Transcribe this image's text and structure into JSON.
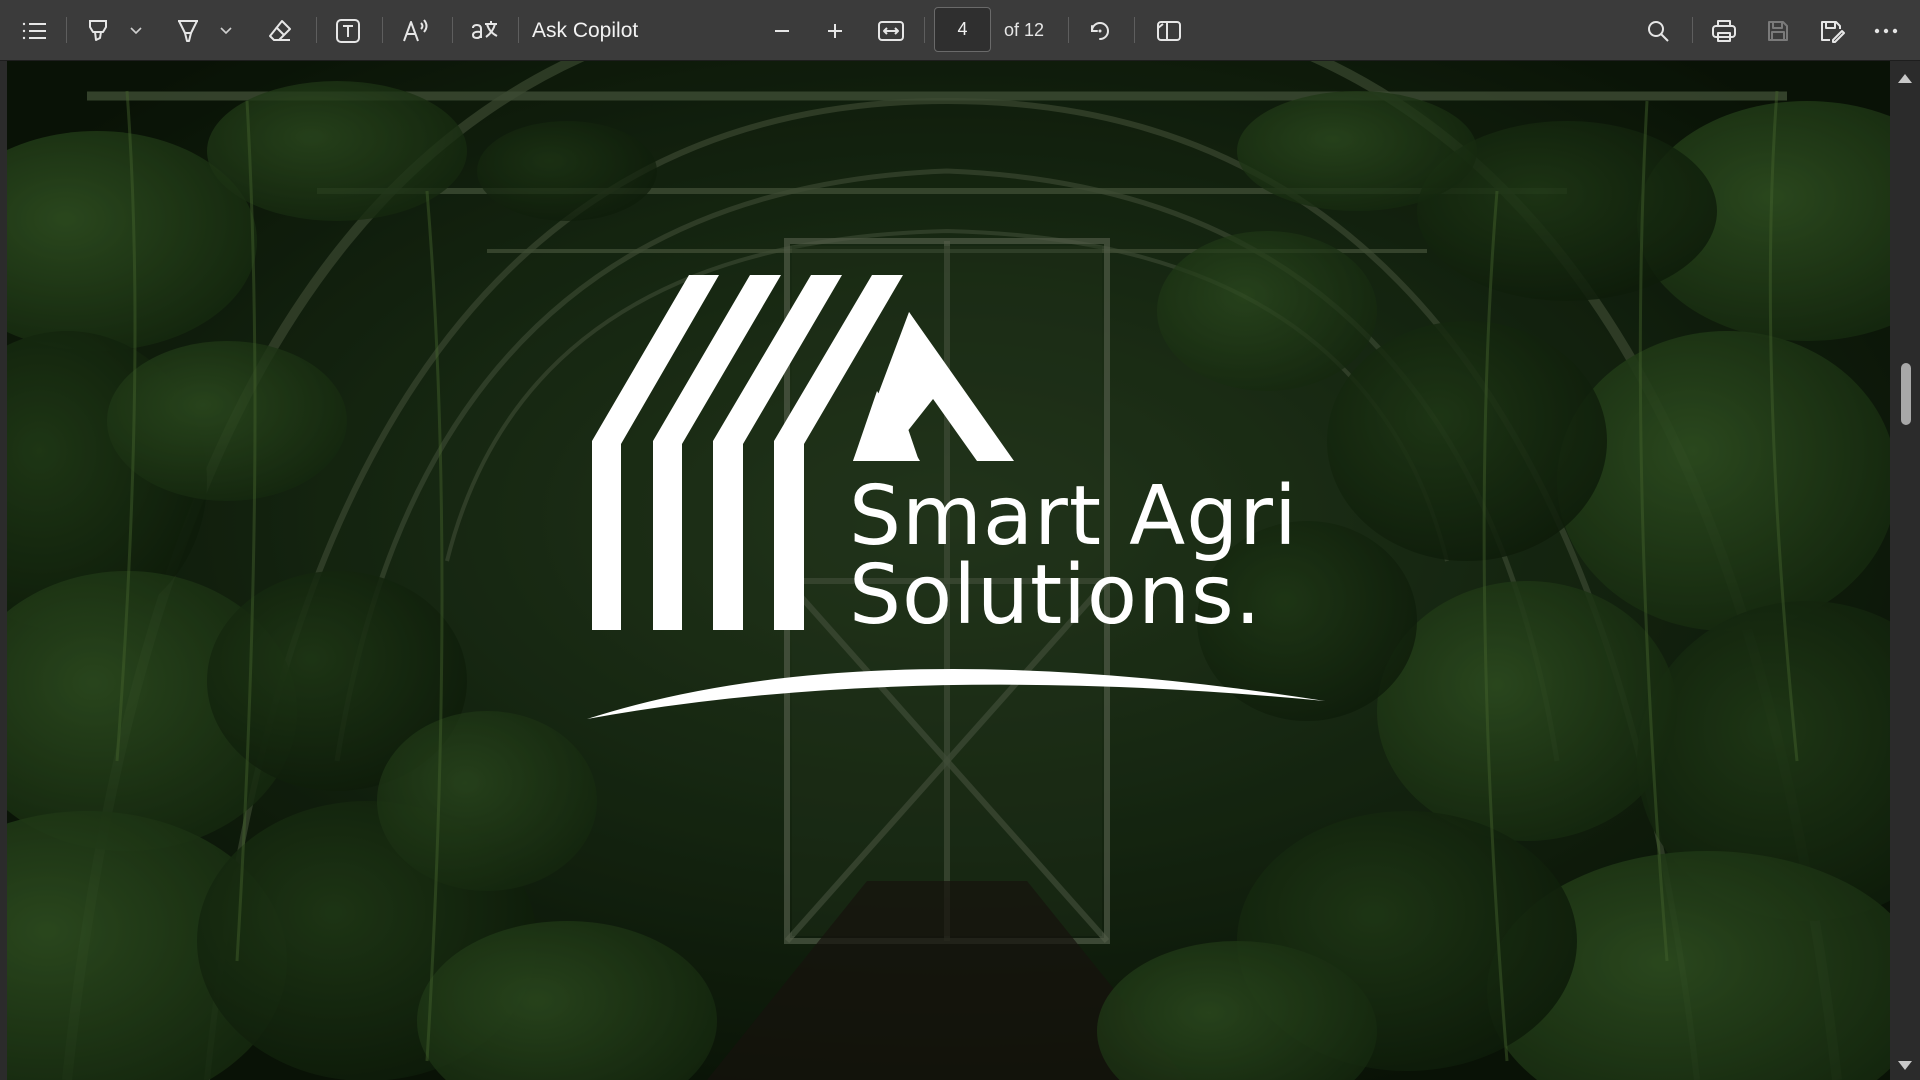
{
  "toolbar": {
    "contents_icon": "table-of-contents-icon",
    "draw_icon": "draw-pen-icon",
    "highlight_icon": "highlighter-icon",
    "erase_icon": "eraser-icon",
    "text_icon": "add-text-icon",
    "read_aloud_icon": "read-aloud-icon",
    "translate_icon": "translate-icon",
    "ask_copilot_label": "Ask Copilot",
    "zoom_out_icon": "minus-icon",
    "zoom_in_icon": "plus-icon",
    "fit_width_icon": "fit-to-width-icon",
    "current_page": "4",
    "page_total_label": "of 12",
    "rotate_icon": "rotate-icon",
    "page_view_icon": "page-view-icon",
    "search_icon": "search-icon",
    "print_icon": "print-icon",
    "save_icon": "save-icon",
    "save_as_icon": "save-as-icon",
    "more_icon": "more-options-icon"
  },
  "document": {
    "brand_line_1": "Smart Agri",
    "brand_line_2": "Solutions.",
    "background": "greenhouse-photo",
    "text_color": "#ffffff"
  },
  "colors": {
    "toolbar_bg": "#3b3b3b",
    "app_bg": "#2b2b2b",
    "icon": "#e6e6e6"
  }
}
